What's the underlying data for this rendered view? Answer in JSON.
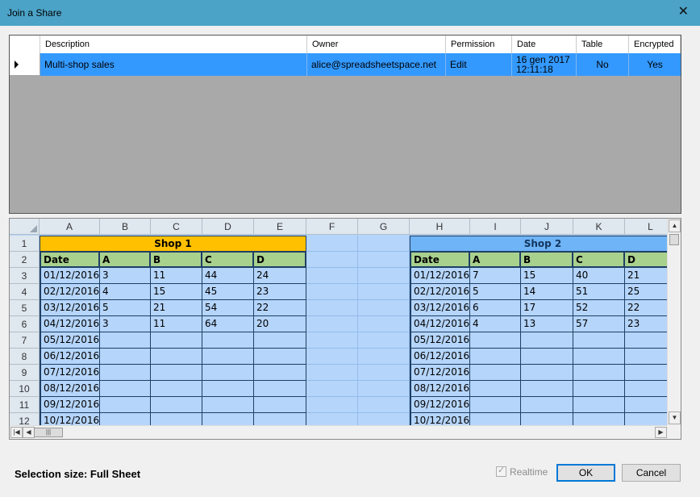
{
  "window": {
    "title": "Join a Share",
    "close_glyph": "✕"
  },
  "shares_table": {
    "columns": [
      "Description",
      "Owner",
      "Permission",
      "Date",
      "Table",
      "Encrypted"
    ],
    "row": {
      "description": "Multi-shop sales",
      "owner": "alice@spreadsheetspace.net",
      "permission": "Edit",
      "date_line1": "16 gen 2017",
      "date_line2": "12:11:18",
      "table": "No",
      "encrypted": "Yes"
    }
  },
  "sheet": {
    "columns": [
      "A",
      "B",
      "C",
      "D",
      "E",
      "F",
      "G",
      "H",
      "I",
      "J",
      "K",
      "L"
    ],
    "row_numbers": [
      "1",
      "2",
      "3",
      "4",
      "5",
      "6",
      "7",
      "8",
      "9",
      "10",
      "11",
      "12"
    ],
    "shop1": {
      "title": "Shop 1",
      "headers": [
        "Date",
        "A",
        "B",
        "C",
        "D"
      ],
      "rows": [
        [
          "01/12/2016",
          "3",
          "11",
          "44",
          "24"
        ],
        [
          "02/12/2016",
          "4",
          "15",
          "45",
          "23"
        ],
        [
          "03/12/2016",
          "5",
          "21",
          "54",
          "22"
        ],
        [
          "04/12/2016",
          "3",
          "11",
          "64",
          "20"
        ],
        [
          "05/12/2016",
          "",
          "",
          "",
          ""
        ],
        [
          "06/12/2016",
          "",
          "",
          "",
          ""
        ],
        [
          "07/12/2016",
          "",
          "",
          "",
          ""
        ],
        [
          "08/12/2016",
          "",
          "",
          "",
          ""
        ],
        [
          "09/12/2016",
          "",
          "",
          "",
          ""
        ],
        [
          "10/12/2016",
          "",
          "",
          "",
          ""
        ]
      ]
    },
    "shop2": {
      "title": "Shop 2",
      "headers": [
        "Date",
        "A",
        "B",
        "C",
        "D"
      ],
      "rows": [
        [
          "01/12/2016",
          "7",
          "15",
          "40",
          "21"
        ],
        [
          "02/12/2016",
          "5",
          "14",
          "51",
          "25"
        ],
        [
          "03/12/2016",
          "6",
          "17",
          "52",
          "22"
        ],
        [
          "04/12/2016",
          "4",
          "13",
          "57",
          "23"
        ],
        [
          "05/12/2016",
          "",
          "",
          "",
          ""
        ],
        [
          "06/12/2016",
          "",
          "",
          "",
          ""
        ],
        [
          "07/12/2016",
          "",
          "",
          "",
          ""
        ],
        [
          "08/12/2016",
          "",
          "",
          "",
          ""
        ],
        [
          "09/12/2016",
          "",
          "",
          "",
          ""
        ],
        [
          "10/12/2016",
          "",
          "",
          "",
          ""
        ]
      ]
    }
  },
  "footer": {
    "selection_size": "Selection size: Full Sheet",
    "realtime_label": "Realtime",
    "ok_label": "OK",
    "cancel_label": "Cancel"
  },
  "colors": {
    "titlebar": "#4ba3c7",
    "selected_row": "#3399ff",
    "shop1_header": "#ffc000",
    "shop2_header": "#6fb4f6",
    "column_header_fill": "#a9d18e",
    "sheet_background": "#b5d5fb"
  }
}
